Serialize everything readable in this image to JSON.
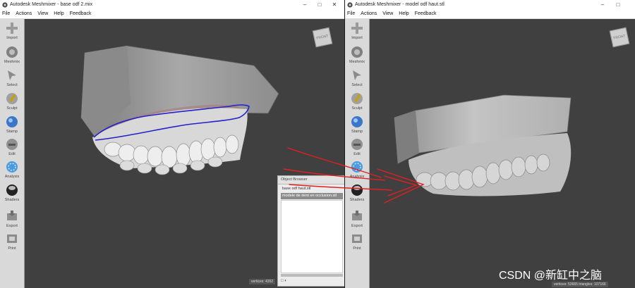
{
  "left_window": {
    "title": "Autodesk Meshmixer - base odf 2.mix",
    "menu": [
      "File",
      "Actions",
      "View",
      "Help",
      "Feedback"
    ],
    "status": "vertices: 4352",
    "cube_label": "FRONT"
  },
  "right_window": {
    "title": "Autodesk Meshmixer - model odf haut.stl",
    "menu": [
      "File",
      "Actions",
      "View",
      "Help",
      "Feedback"
    ],
    "status": "vertices: 53665  triangles: 107166",
    "cube_label": "FRONT"
  },
  "tools": [
    "Import",
    "Meshmix",
    "Select",
    "Sculpt",
    "Stamp",
    "Edit",
    "Analysis",
    "Shaders",
    "Export",
    "Print"
  ],
  "object_browser": {
    "title": "Object Browser",
    "items": [
      "base odf haut.stl",
      "modele de dent en occlusion.stl"
    ]
  },
  "watermark": "CSDN @新缸中之脑",
  "colors": {
    "annotation": "#e02020",
    "selection": "#2222cc",
    "viewport": "#404040"
  }
}
